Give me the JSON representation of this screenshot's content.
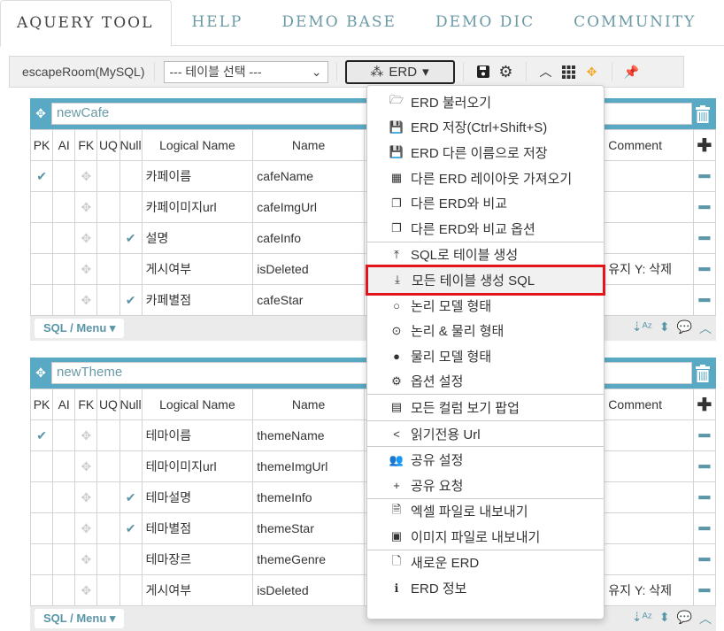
{
  "nav": {
    "tabs": [
      {
        "label": "AQUERY TOOL",
        "active": true
      },
      {
        "label": "HELP",
        "active": false
      },
      {
        "label": "DEMO BASE",
        "active": false
      },
      {
        "label": "DEMO DIC",
        "active": false
      },
      {
        "label": "COMMUNITY",
        "active": false
      }
    ]
  },
  "toolbar": {
    "db_label": "escapeRoom(MySQL)",
    "table_select": "--- 테이블 선택 ---",
    "erd_button": "ERD",
    "icons": [
      "save-icon",
      "gear-icon",
      "chevron-up-icon",
      "grid-icon",
      "move-icon",
      "pin-icon"
    ]
  },
  "colors": {
    "accent": "#5aa9c4",
    "check": "#5a96a8",
    "highlight": "#e3151a",
    "orange": "#f5a623"
  },
  "columns_header": [
    "PK",
    "AI",
    "FK",
    "UQ",
    "Null",
    "Logical Name",
    "Name",
    "Comment"
  ],
  "tables": [
    {
      "name": "newCafe",
      "rows": [
        {
          "pk": true,
          "null": false,
          "logical": "카페이름",
          "name": "cafeName",
          "comment": ""
        },
        {
          "pk": false,
          "null": false,
          "logical": "카페이미지url",
          "name": "cafeImgUrl",
          "comment": ""
        },
        {
          "pk": false,
          "null": true,
          "logical": "설명",
          "name": "cafeInfo",
          "comment": ""
        },
        {
          "pk": false,
          "null": false,
          "logical": "게시여부",
          "name": "isDeleted",
          "comment": "유지 Y:  삭제"
        },
        {
          "pk": false,
          "null": true,
          "logical": "카페별점",
          "name": "cafeStar",
          "comment": ""
        }
      ],
      "footer": "SQL / Menu"
    },
    {
      "name": "newTheme",
      "rows": [
        {
          "pk": true,
          "null": false,
          "logical": "테마이름",
          "name": "themeName",
          "comment": ""
        },
        {
          "pk": false,
          "null": false,
          "logical": "테마이미지url",
          "name": "themeImgUrl",
          "comment": ""
        },
        {
          "pk": false,
          "null": true,
          "logical": "테마설명",
          "name": "themeInfo",
          "comment": ""
        },
        {
          "pk": false,
          "null": true,
          "logical": "테마별점",
          "name": "themeStar",
          "comment": ""
        },
        {
          "pk": false,
          "null": false,
          "logical": "테마장르",
          "name": "themeGenre",
          "comment": ""
        },
        {
          "pk": false,
          "null": false,
          "logical": "게시여부",
          "name": "isDeleted",
          "comment": "유지 Y:  삭제"
        }
      ],
      "footer": "SQL / Menu"
    }
  ],
  "dropdown": {
    "items": [
      {
        "label": "ERD 불러오기",
        "icon": "folder-open-icon",
        "glyph": "🗁"
      },
      {
        "label": "ERD 저장(Ctrl+Shift+S)",
        "icon": "save-icon",
        "glyph": "💾"
      },
      {
        "label": "ERD 다른 이름으로 저장",
        "icon": "save-as-icon",
        "glyph": "💾"
      },
      {
        "label": "다른 ERD 레이아웃 가져오기",
        "icon": "layout-icon",
        "glyph": "▦"
      },
      {
        "label": "다른 ERD와 비교",
        "icon": "compare-icon",
        "glyph": "❐"
      },
      {
        "label": "다른 ERD와 비교 옵션",
        "icon": "compare-options-icon",
        "glyph": "❐",
        "divider_after": true
      },
      {
        "label": "SQL로 테이블 생성",
        "icon": "upload-icon",
        "glyph": "⤒"
      },
      {
        "label": "모든 테이블 생성 SQL",
        "icon": "download-icon",
        "glyph": "⤓",
        "highlight": true
      },
      {
        "label": "논리 모델 형태",
        "icon": "radio-empty-icon",
        "glyph": "○"
      },
      {
        "label": "논리 & 물리 형태",
        "icon": "radio-checked-icon",
        "glyph": "⊙"
      },
      {
        "label": "물리 모델 형태",
        "icon": "circle-filled-icon",
        "glyph": "●"
      },
      {
        "label": "옵션 설정",
        "icon": "gear-icon",
        "glyph": "⚙",
        "divider_after": true
      },
      {
        "label": "모든 컬럼 보기 팝업",
        "icon": "list-icon",
        "glyph": "▤",
        "divider_after": true
      },
      {
        "label": "읽기전용 Url",
        "icon": "share-icon",
        "glyph": "<",
        "divider_after": true
      },
      {
        "label": "공유 설정",
        "icon": "users-icon",
        "glyph": "👥"
      },
      {
        "label": "공유 요청",
        "icon": "user-plus-icon",
        "glyph": "+",
        "divider_after": true
      },
      {
        "label": "엑셀 파일로 내보내기",
        "icon": "excel-file-icon",
        "glyph": "🗎"
      },
      {
        "label": "이미지 파일로 내보내기",
        "icon": "image-icon",
        "glyph": "▣",
        "divider_after": true
      },
      {
        "label": "새로운 ERD",
        "icon": "new-file-icon",
        "glyph": "🗋"
      },
      {
        "label": "ERD 정보",
        "icon": "info-icon",
        "glyph": "ℹ"
      }
    ]
  }
}
